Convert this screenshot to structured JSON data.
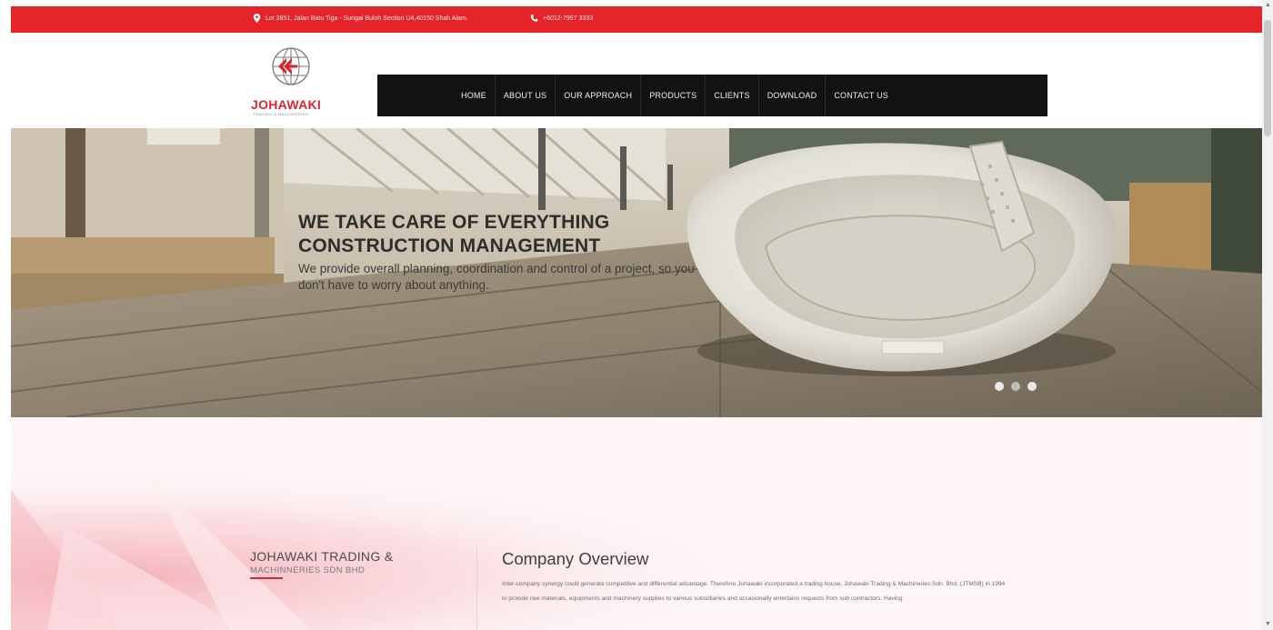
{
  "topbar": {
    "address": "Lot 3851, Jalan Batu Tiga - Sungai Buloh Section U4,40150 Shah Alam.",
    "phone": "+6012-7997 3333"
  },
  "logo": {
    "name": "JOHAWAKI",
    "tagline": "TRADING & MACHINERIES"
  },
  "nav": {
    "items": [
      "HOME",
      "ABOUT US",
      "OUR APPROACH",
      "PRODUCTS",
      "CLIENTS",
      "DOWNLOAD",
      "CONTACT US"
    ]
  },
  "hero": {
    "title_line1": "WE TAKE CARE OF EVERYTHING",
    "title_line2": "CONSTRUCTION MANAGEMENT",
    "description": "We provide overall planning, coordination and control of a project, so you don't have to worry about anything.",
    "slides_count": 3,
    "active_slide": 2
  },
  "about": {
    "company_name": "JOHAWAKI TRADING &",
    "company_sub": "MACHINNERIES SDN BHD",
    "overview_title": "Company Overview",
    "overview_body": "Inter-company synergy could generate competitive and differential advantage. Therefore Johawaki incorporated a trading house, Johawaki Trading & Machineries Sdn. Bhd. (JTMSB) in 1994 to provide raw materials, equipments and machinery supplies to various subsidiaries and occasionally entertains requests from sub contractors. Having"
  },
  "colors": {
    "brand_red": "#e3242b",
    "nav_bg": "#121212"
  }
}
